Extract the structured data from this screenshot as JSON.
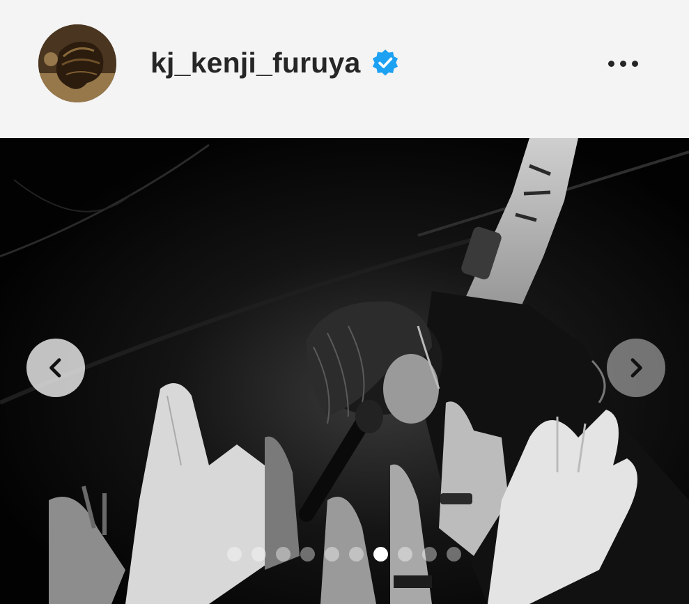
{
  "post": {
    "username": "kj_kenji_furuya",
    "verified": true,
    "verified_color": "#1da1f2"
  },
  "icons": {
    "more": "more-options-icon",
    "prev": "chevron-left-icon",
    "next": "chevron-right-icon",
    "verified": "verified-badge-icon"
  },
  "carousel": {
    "total_slides": 10,
    "active_index": 6
  }
}
